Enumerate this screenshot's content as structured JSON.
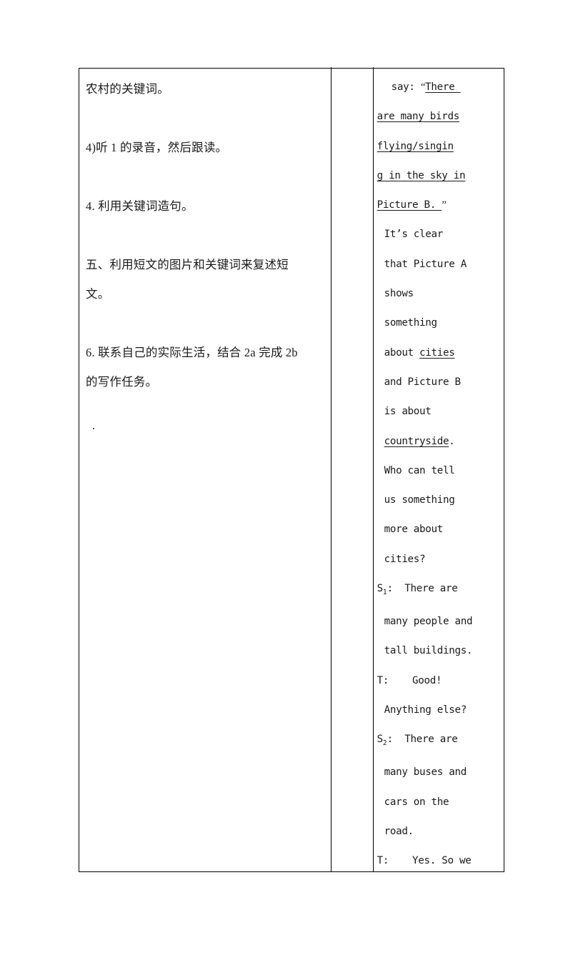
{
  "document": {
    "type": "lesson-plan-table",
    "columns": 3
  },
  "left_column": {
    "paragraphs": [
      "农村的关键词。",
      "4)听 1 的录音，然后跟读。",
      "4. 利用关键词造句。",
      "五、利用短文的图片和关键词来复述短\n文。",
      "6. 联系自己的实际生活，结合 2a 完成 2b\n的写作任务。",
      "."
    ],
    "p0": "农村的关键词。",
    "p1": "4)听 1 的录音，然后跟读。",
    "p2": "4. 利用关键词造句。",
    "p3": "五、利用短文的图片和关键词来复述短\n文。",
    "p4": "6. 联系自己的实际生活，结合 2a 完成 2b\n的写作任务。",
    "p5": "."
  },
  "middle_column": {
    "content": ""
  },
  "right_column": {
    "lines": [
      {
        "indent": 2,
        "segments": [
          {
            "text": "say: ",
            "underline": false
          },
          {
            "text": "“",
            "underline": false,
            "quote": "open"
          },
          {
            "text": "There ",
            "underline": true
          }
        ]
      },
      {
        "indent": 0,
        "segments": [
          {
            "text": "are many birds",
            "underline": true
          }
        ]
      },
      {
        "indent": 0,
        "segments": [
          {
            "text": "flying/singin",
            "underline": true
          }
        ]
      },
      {
        "indent": 0,
        "segments": [
          {
            "text": "g in the sky in",
            "underline": true
          }
        ]
      },
      {
        "indent": 0,
        "segments": [
          {
            "text": "Picture B. ",
            "underline": true
          },
          {
            "text": "”",
            "underline": false,
            "quote": "close"
          }
        ]
      },
      {
        "indent": 1,
        "segments": [
          {
            "text": "It’s clear",
            "underline": false
          }
        ]
      },
      {
        "indent": 1,
        "segments": [
          {
            "text": "that Picture A",
            "underline": false
          }
        ]
      },
      {
        "indent": 1,
        "segments": [
          {
            "text": "shows",
            "underline": false
          }
        ]
      },
      {
        "indent": 1,
        "segments": [
          {
            "text": "something",
            "underline": false
          }
        ]
      },
      {
        "indent": 1,
        "segments": [
          {
            "text": "about ",
            "underline": false
          },
          {
            "text": "cities",
            "underline": true
          }
        ]
      },
      {
        "indent": 1,
        "segments": [
          {
            "text": "and Picture B",
            "underline": false
          }
        ]
      },
      {
        "indent": 1,
        "segments": [
          {
            "text": "is about",
            "underline": false
          }
        ]
      },
      {
        "indent": 1,
        "segments": [
          {
            "text": "countryside",
            "underline": true
          },
          {
            "text": ".",
            "underline": false
          }
        ]
      },
      {
        "indent": 1,
        "segments": [
          {
            "text": "Who can tell",
            "underline": false
          }
        ]
      },
      {
        "indent": 1,
        "segments": [
          {
            "text": "us something",
            "underline": false
          }
        ]
      },
      {
        "indent": 1,
        "segments": [
          {
            "text": "more about",
            "underline": false
          }
        ]
      },
      {
        "indent": 1,
        "segments": [
          {
            "text": "cities?",
            "underline": false
          }
        ]
      },
      {
        "indent": 0,
        "segments": [
          {
            "text": "S",
            "underline": false
          },
          {
            "text": "1",
            "underline": false,
            "sub": true
          },
          {
            "text": ":  There are",
            "underline": false
          }
        ]
      },
      {
        "indent": 1,
        "segments": [
          {
            "text": "many people and",
            "underline": false
          }
        ]
      },
      {
        "indent": 1,
        "segments": [
          {
            "text": "tall buildings.",
            "underline": false
          }
        ]
      },
      {
        "indent": 0,
        "segments": [
          {
            "text": "T:    Good!",
            "underline": false
          }
        ]
      },
      {
        "indent": 1,
        "segments": [
          {
            "text": "Anything else?",
            "underline": false
          }
        ]
      },
      {
        "indent": 0,
        "segments": [
          {
            "text": "S",
            "underline": false
          },
          {
            "text": "2",
            "underline": false,
            "sub": true
          },
          {
            "text": ":  There are",
            "underline": false
          }
        ]
      },
      {
        "indent": 1,
        "segments": [
          {
            "text": "many buses and",
            "underline": false
          }
        ]
      },
      {
        "indent": 1,
        "segments": [
          {
            "text": "cars on the",
            "underline": false
          }
        ]
      },
      {
        "indent": 1,
        "segments": [
          {
            "text": "road.",
            "underline": false
          }
        ]
      },
      {
        "indent": 0,
        "segments": [
          {
            "text": "T:    Yes. So we",
            "underline": false
          }
        ]
      }
    ]
  },
  "colors": {
    "border": "#000000",
    "text": "#1a1a1a",
    "background": "#ffffff"
  }
}
